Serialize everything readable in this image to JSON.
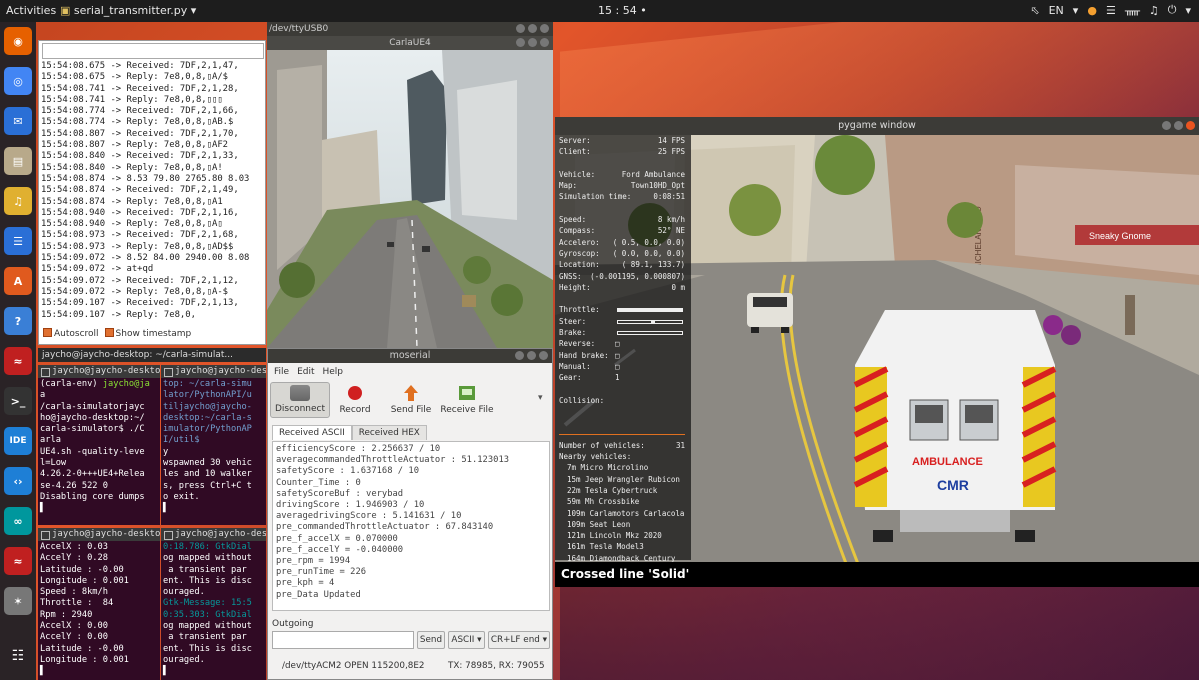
{
  "topbar": {
    "activities": "Activities",
    "app_name": "serial_transmitter.py",
    "app_arrow": "▾",
    "clock": "15 : 54",
    "lang": "EN",
    "tray_icons": [
      "night-light-icon",
      "wifi-icon",
      "bluetooth-icon",
      "volume-icon",
      "power-icon"
    ]
  },
  "dock": {
    "items": [
      {
        "name": "firefox-icon",
        "color": "#e66000"
      },
      {
        "name": "chrome-icon",
        "color": "#4285f4"
      },
      {
        "name": "thunderbird-icon",
        "color": "#2a6fd6"
      },
      {
        "name": "files-icon",
        "color": "#b8a98a"
      },
      {
        "name": "rhythmbox-icon",
        "color": "#e0b030"
      },
      {
        "name": "writer-icon",
        "color": "#2a6fd6"
      },
      {
        "name": "software-icon",
        "color": "#e05a1e"
      },
      {
        "name": "help-icon",
        "color": "#3a7fd6"
      },
      {
        "name": "system-monitor-icon",
        "color": "#c02020"
      },
      {
        "name": "terminal-icon",
        "color": "#333333"
      },
      {
        "name": "ide-icon",
        "color": "#1e7fd6"
      },
      {
        "name": "vscode-icon",
        "color": "#1e7fd6"
      },
      {
        "name": "arduino-icon",
        "color": "#00979d"
      },
      {
        "name": "system-monitor-icon-2",
        "color": "#c02020"
      },
      {
        "name": "satellite-icon",
        "color": "#777777"
      }
    ],
    "apps_grid": "apps-grid-icon"
  },
  "serial_window": {
    "log": [
      "15:54:08.675 -> Received: 7DF,2,1,47,",
      "15:54:08.675 -> Reply: 7e8,0,8,▯A/$",
      "15:54:08.741 -> Received: 7DF,2,1,28,",
      "15:54:08.741 -> Reply: 7e8,0,8,▯▯▯",
      "15:54:08.774 -> Received: 7DF,2,1,66,",
      "15:54:08.774 -> Reply: 7e8,0,8,▯AB.$",
      "15:54:08.807 -> Received: 7DF,2,1,70,",
      "15:54:08.807 -> Reply: 7e8,0,8,▯AF2",
      "15:54:08.840 -> Received: 7DF,2,1,33,",
      "15:54:08.840 -> Reply: 7e8,0,8,▯A!",
      "15:54:08.874 -> 8.53 79.80 2765.80 8.03",
      "15:54:08.874 -> Received: 7DF,2,1,49,",
      "15:54:08.874 -> Reply: 7e8,0,8,▯A1",
      "15:54:08.940 -> Received: 7DF,2,1,16,",
      "15:54:08.940 -> Reply: 7e8,0,8,▯A▯",
      "15:54:08.973 -> Received: 7DF,2,1,68,",
      "15:54:08.973 -> Reply: 7e8,0,8,▯AD$$",
      "15:54:09.072 -> 8.52 84.00 2940.00 8.08",
      "15:54:09.072 -> at+qd",
      "15:54:09.072 -> Received: 7DF,2,1,12,",
      "15:54:09.072 -> Reply: 7e8,0,8,▯A-$",
      "15:54:09.107 -> Received: 7DF,2,1,13,",
      "15:54:09.107 -> Reply: 7e8,0,"
    ],
    "autoscroll": "Autoscroll",
    "show_timestamp": "Show timestamp"
  },
  "terminal": {
    "title": "jaycho@jaycho-desktop: ~/carla-simulat...",
    "tab1": "jaycho@jaycho-desktop: ~/c...",
    "tab2": "jaycho@jaycho-desktop: ~/c...",
    "tab3": "jaycho@jaycho-desktop: ~/c...",
    "tab4": "jaycho@jaycho-desktop: ~/c...",
    "pane1": {
      "env": "(carla-env) ",
      "prompt": "jaycho@ja",
      "lines": [
        "a",
        "/carla-simulatorjayc",
        "ho@jaycho-desktop:~/",
        "carla-simulator$ ./C",
        "arla",
        "UE4.sh -quality-leve",
        "l=Low",
        "4.26.2-0+++UE4+Relea",
        "se-4.26 522 0",
        "Disabling core dumps",
        "▌"
      ]
    },
    "pane2": {
      "lines": [
        "top: ~/carla-simu",
        "lator/PythonAPI/u",
        "tiljaycho@jaycho-",
        "desktop:~/carla-s",
        "imulator/PythonAP",
        "I/util$ ",
        "y",
        "wspawned 30 vehic",
        "les and 10 walker",
        "s, press Ctrl+C t",
        "o exit.",
        "▌"
      ]
    },
    "pane3": {
      "lines": [
        "AccelX : 0.03",
        "AccelY : 0.28",
        "Latitude : -0.00",
        "Longitude : 0.001",
        "Speed : 8km/h",
        "Throttle :  84",
        "Rpm : 2940",
        "AccelX : 0.00",
        "AccelY : 0.00",
        "Latitude : -0.00",
        "Longitude : 0.001",
        "▌"
      ]
    },
    "pane4": {
      "lines": [
        "0:18.786: GtkDial",
        "og mapped without",
        " a transient par",
        "ent. This is disc",
        "ouraged.",
        "Gtk-Message: 15:5",
        "0:35.303: GtkDial",
        "og mapped without",
        " a transient par",
        "ent. This is disc",
        "ouraged.",
        "▌"
      ]
    }
  },
  "carla_window": {
    "subtitle": "/dev/ttyUSB0",
    "title": "CarlaUE4"
  },
  "moserial": {
    "title": "moserial",
    "menu": [
      "File",
      "Edit",
      "Help"
    ],
    "toolbar": {
      "disconnect": "Disconnect",
      "record": "Record",
      "send_file": "Send File",
      "receive_file": "Receive File"
    },
    "tab_ascii": "Received ASCII",
    "tab_hex": "Received HEX",
    "received_lines": [
      "efficiencyScore : 2.256637 / 10",
      "averagecommandedThrottleActuator : 51.123013",
      "safetyScore : 1.637168 / 10",
      "Counter_Time : 0",
      "safetyScoreBuf : verybad",
      "drivingScore : 1.946903 / 10",
      "averagedrivingScore : 5.141631 / 10",
      "pre_commandedThrottleActuator : 67.843140",
      "pre_f_accelX = 0.070000",
      "pre_f_accelY = -0.040000",
      "pre_rpm = 1994",
      "pre_runTime = 226",
      "pre_kph = 4",
      "pre_Data Updated"
    ],
    "outgoing_label": "Outgoing",
    "send": "Send",
    "encoding": "ASCII",
    "line_end": "CR+LF end",
    "status_left": "/dev/ttyACM2 OPEN 115200,8E2",
    "status_right": "TX: 78985, RX: 79055"
  },
  "pygame": {
    "title": "pygame window",
    "hud": {
      "server": "Server:",
      "server_val": "14 FPS",
      "client": "Client:",
      "client_val": "25 FPS",
      "vehicle": "Vehicle:",
      "vehicle_val": "Ford Ambulance",
      "map": "Map:",
      "map_val": "Town10HD_Opt",
      "sim_time": "Simulation time:",
      "sim_time_val": "0:08:51",
      "speed": "Speed:",
      "speed_val": "8 km/h",
      "compass": "Compass:",
      "compass_val": "52° NE",
      "accelero": "Accelero:",
      "accelero_val": "( 0.5, 0.0, 0.0)",
      "gyroscope": "Gyroscop:",
      "gyroscope_val": "( 0.0, 0.0, 0.0)",
      "location": "Location:",
      "location_val": "( 89.1, 133.7)",
      "gnss": "GNSS:",
      "gnss_val": "(-0.001195, 0.000807)",
      "height": "Height:",
      "height_val": "0 m",
      "throttle": "Throttle:",
      "throttle_level": 1.0,
      "steer": "Steer:",
      "steer_level": 0.55,
      "brake": "Brake:",
      "brake_level": 0,
      "reverse": "Reverse:",
      "hand_brake": "Hand brake:",
      "manual": "Manual:",
      "gear": "Gear:",
      "gear_val": "1",
      "collision": "Collision:",
      "num_vehicles": "Number of vehicles:",
      "num_vehicles_val": "31",
      "nearby": "Nearby vehicles:",
      "nearby_list": [
        "7m Micro Microlino",
        "15m Jeep Wrangler Rubicon",
        "22m Tesla Cybertruck",
        "59m Mh Crossbike",
        "109m Carlamotors Carlacola",
        "109m Seat Leon",
        "121m Lincoln Mkz 2020",
        "161m Tesla Model3",
        "164m Diamondback Century"
      ]
    },
    "banner": "Crossed line 'Solid'",
    "ambulance_text": "AMBULANCE",
    "cmr_text": "CMR",
    "sign_text": "Sneaky Gnome",
    "signs": [
      "MICHELANGELO"
    ]
  },
  "colors": {
    "terminal_bg": "#300a24",
    "ubuntu_orange": "#e95420",
    "topbar_bg": "#1d1d1d"
  }
}
